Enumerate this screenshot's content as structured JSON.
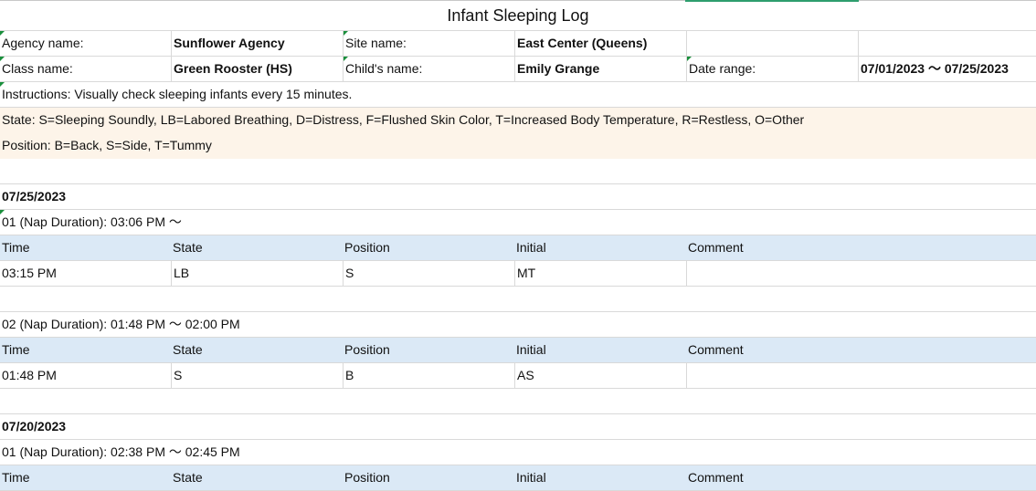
{
  "title": "Infant Sleeping Log",
  "header": {
    "agency_label": "Agency name:",
    "agency_value": "Sunflower Agency",
    "site_label": "Site name:",
    "site_value": "East Center (Queens)",
    "class_label": "Class name:",
    "class_value": "Green Rooster (HS)",
    "child_label": "Child's name:",
    "child_value": "Emily Grange",
    "date_label": "Date range:",
    "date_value": "07/01/2023 ～ 07/25/2023"
  },
  "instructions": "Instructions: Visually check sleeping infants every 15 minutes.",
  "state_legend": "State: S=Sleeping Soundly, LB=Labored Breathing, D=Distress, F=Flushed Skin Color, T=Increased Body Temperature, R=Restless, O=Other",
  "position_legend": "Position: B=Back, S=Side, T=Tummy",
  "columns": [
    "Time",
    "State",
    "Position",
    "Initial",
    "Comment"
  ],
  "days": [
    {
      "date": "07/25/2023",
      "naps": [
        {
          "label": "01 (Nap Duration): 03:06 PM ～",
          "rows": [
            [
              "03:15 PM",
              "LB",
              "S",
              "MT",
              ""
            ]
          ]
        },
        {
          "label": "02 (Nap Duration): 01:48 PM ～ 02:00 PM",
          "rows": [
            [
              "01:48 PM",
              "S",
              "B",
              "AS",
              ""
            ]
          ]
        }
      ]
    },
    {
      "date": "07/20/2023",
      "naps": [
        {
          "label": "01 (Nap Duration): 02:38 PM ～ 02:45 PM",
          "rows": []
        }
      ]
    }
  ]
}
